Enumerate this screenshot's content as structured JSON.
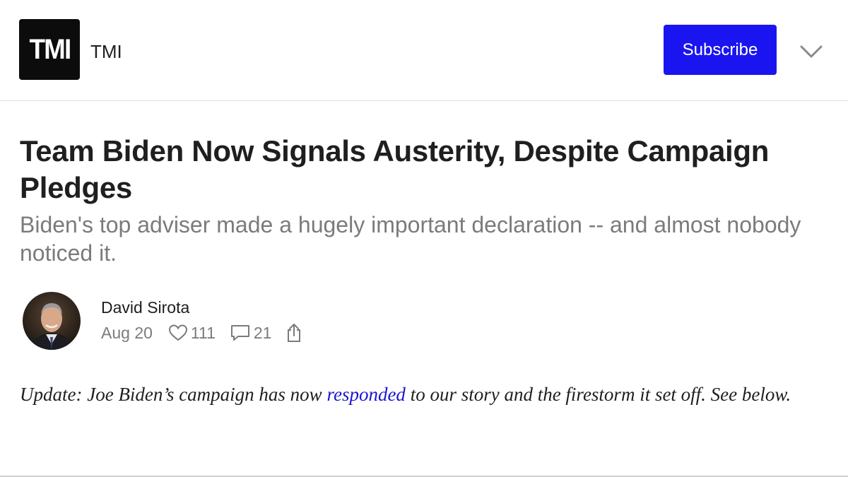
{
  "header": {
    "logo_text": "TMI",
    "publication_name": "TMI",
    "subscribe_label": "Subscribe",
    "dropdown_icon": "chevron-down-icon",
    "accent_color": "#1a15f0"
  },
  "article": {
    "title": "Team Biden Now Signals Austerity, Despite Campaign Pledges",
    "subtitle": "Biden's top adviser made a hugely important declaration -- and almost nobody noticed it.",
    "author": "David Sirota",
    "date": "Aug 20",
    "likes": "111",
    "comments": "21",
    "like_icon": "heart-icon",
    "comment_icon": "comment-icon",
    "share_icon": "share-icon",
    "update": {
      "before": "Update: Joe Biden’s campaign has now ",
      "link_text": "responded",
      "after": " to our story and the firestorm it set off. See below."
    }
  }
}
